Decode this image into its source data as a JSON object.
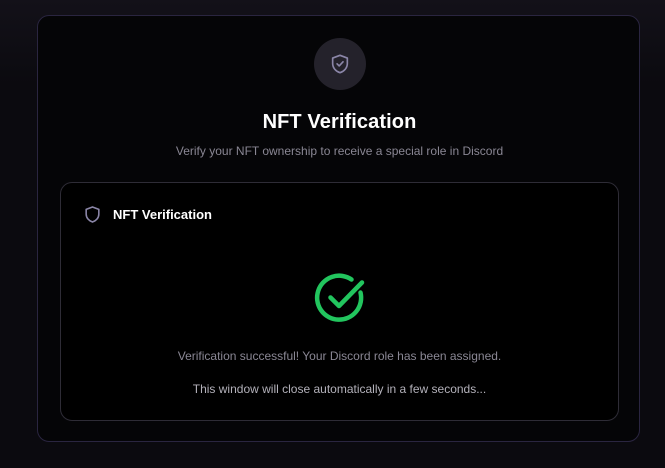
{
  "header": {
    "icon": "shield-check-icon",
    "title": "NFT Verification",
    "subtitle": "Verify your NFT ownership to receive a special role in Discord"
  },
  "panel": {
    "icon": "shield-icon",
    "title": "NFT Verification",
    "status_icon": "check-circle-icon",
    "status": "success",
    "success_message": "Verification successful! Your Discord role has been assigned.",
    "close_notice": "This window will close automatically in a few seconds..."
  },
  "colors": {
    "background": "#0b0a0f",
    "card_border": "#2a2540",
    "success": "#22c55e",
    "muted_text": "#8a8794",
    "shield_icon": "#8b86a8"
  }
}
